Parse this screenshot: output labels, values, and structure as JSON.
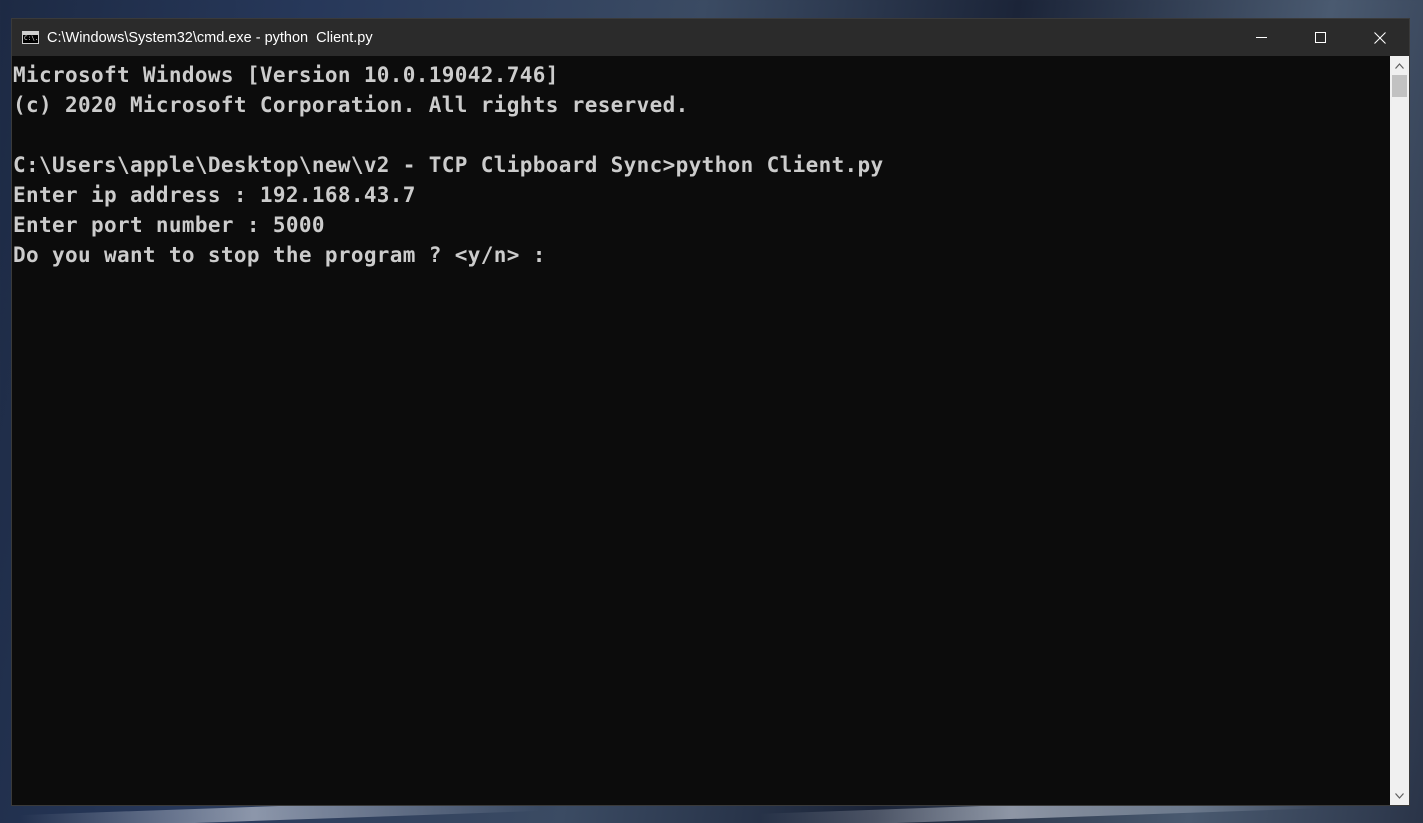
{
  "window": {
    "title": "C:\\Windows\\System32\\cmd.exe - python  Client.py",
    "icon_label": "C:\\."
  },
  "controls": {
    "minimize_icon": "minimize-icon",
    "maximize_icon": "maximize-icon",
    "close_icon": "close-icon"
  },
  "console": {
    "lines": [
      "Microsoft Windows [Version 10.0.19042.746]",
      "(c) 2020 Microsoft Corporation. All rights reserved.",
      "",
      "C:\\Users\\apple\\Desktop\\new\\v2 - TCP Clipboard Sync>python Client.py",
      "Enter ip address : 192.168.43.7",
      "Enter port number : 5000",
      "Do you want to stop the program ? <y/n> :"
    ]
  },
  "colors": {
    "console_background": "#0c0c0c",
    "console_text": "#cccccc",
    "titlebar": "#2b2b2b"
  }
}
